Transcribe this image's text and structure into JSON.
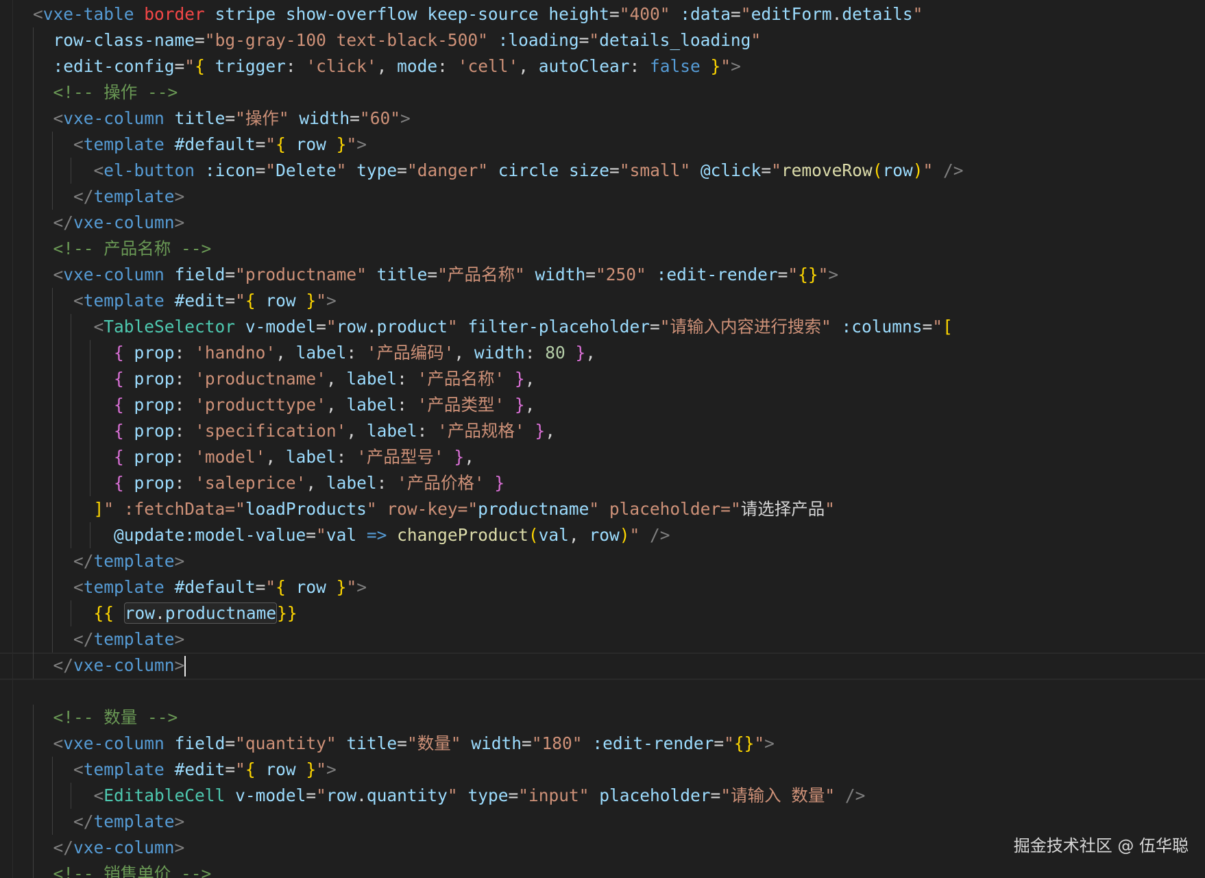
{
  "editor": {
    "lines": [
      "<vxe-table border stripe show-overflow keep-source height=\"400\" :data=\"editForm.details\"",
      "  row-class-name=\"bg-gray-100 text-black-500\" :loading=\"details_loading\"",
      "  :edit-config=\"{ trigger: 'click', mode: 'cell', autoClear: false }\">",
      "  <!-- 操作 -->",
      "  <vxe-column title=\"操作\" width=\"60\">",
      "    <template #default=\"{ row }\">",
      "      <el-button :icon=\"Delete\" type=\"danger\" circle size=\"small\" @click=\"removeRow(row)\" />",
      "    </template>",
      "  </vxe-column>",
      "  <!-- 产品名称 -->",
      "  <vxe-column field=\"productname\" title=\"产品名称\" width=\"250\" :edit-render=\"{}\">",
      "    <template #edit=\"{ row }\">",
      "      <TableSelector v-model=\"row.product\" filter-placeholder=\"请输入内容进行搜索\" :columns=\"[",
      "        { prop: 'handno', label: '产品编码', width: 80 },",
      "        { prop: 'productname', label: '产品名称' },",
      "        { prop: 'producttype', label: '产品类型' },",
      "        { prop: 'specification', label: '产品规格' },",
      "        { prop: 'model', label: '产品型号' },",
      "        { prop: 'saleprice', label: '产品价格' }",
      "      ]\" :fetchData=\"loadProducts\" row-key=\"productname\" placeholder=\"请选择产品\"",
      "        @update:model-value=\"val => changeProduct(val, row)\" />",
      "    </template>",
      "    <template #default=\"{ row }\">",
      "      {{ row.productname }}",
      "    </template>",
      "  </vxe-column>",
      "",
      "  <!-- 数量 -->",
      "  <vxe-column field=\"quantity\" title=\"数量\" width=\"180\" :edit-render=\"{}\">",
      "    <template #edit=\"{ row }\">",
      "      <EditableCell v-model=\"row.quantity\" type=\"input\" placeholder=\"请输入 数量\" />",
      "    </template>",
      "  </vxe-column>",
      "  <!-- 销售单价 -->"
    ]
  },
  "watermark": "掘金技术社区 @ 伍华聪"
}
